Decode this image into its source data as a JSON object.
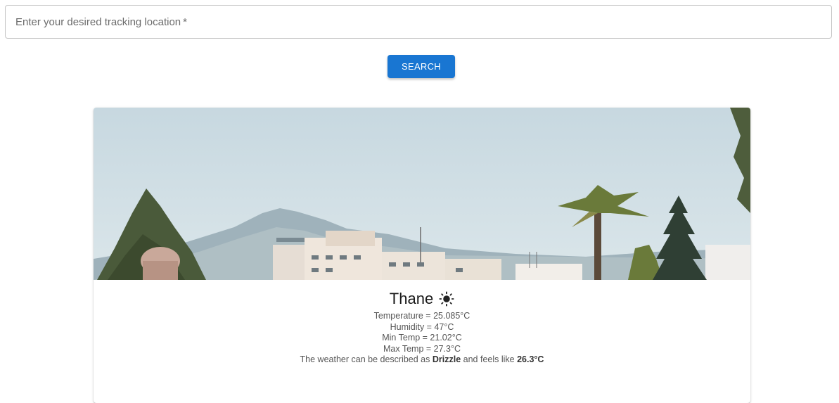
{
  "search": {
    "placeholder": "Enter your desired tracking location",
    "required_marker": "*",
    "button_label": "SEARCH"
  },
  "colors": {
    "primary": "#1976d2",
    "sky": "#c9dbe3",
    "mountain": "#8fa7b3"
  },
  "weather": {
    "city": "Thane",
    "condition_icon": "sun-icon",
    "temperature": "Temperature = 25.085°C",
    "humidity": "Humidity = 47°C",
    "min_temp": "Min Temp = 21.02°C",
    "max_temp": "Max Temp = 27.3°C",
    "description_prefix": "The weather can be described as",
    "description_condition": "Drizzle",
    "description_middle": "and feels like",
    "description_feels": "26.3°C"
  }
}
